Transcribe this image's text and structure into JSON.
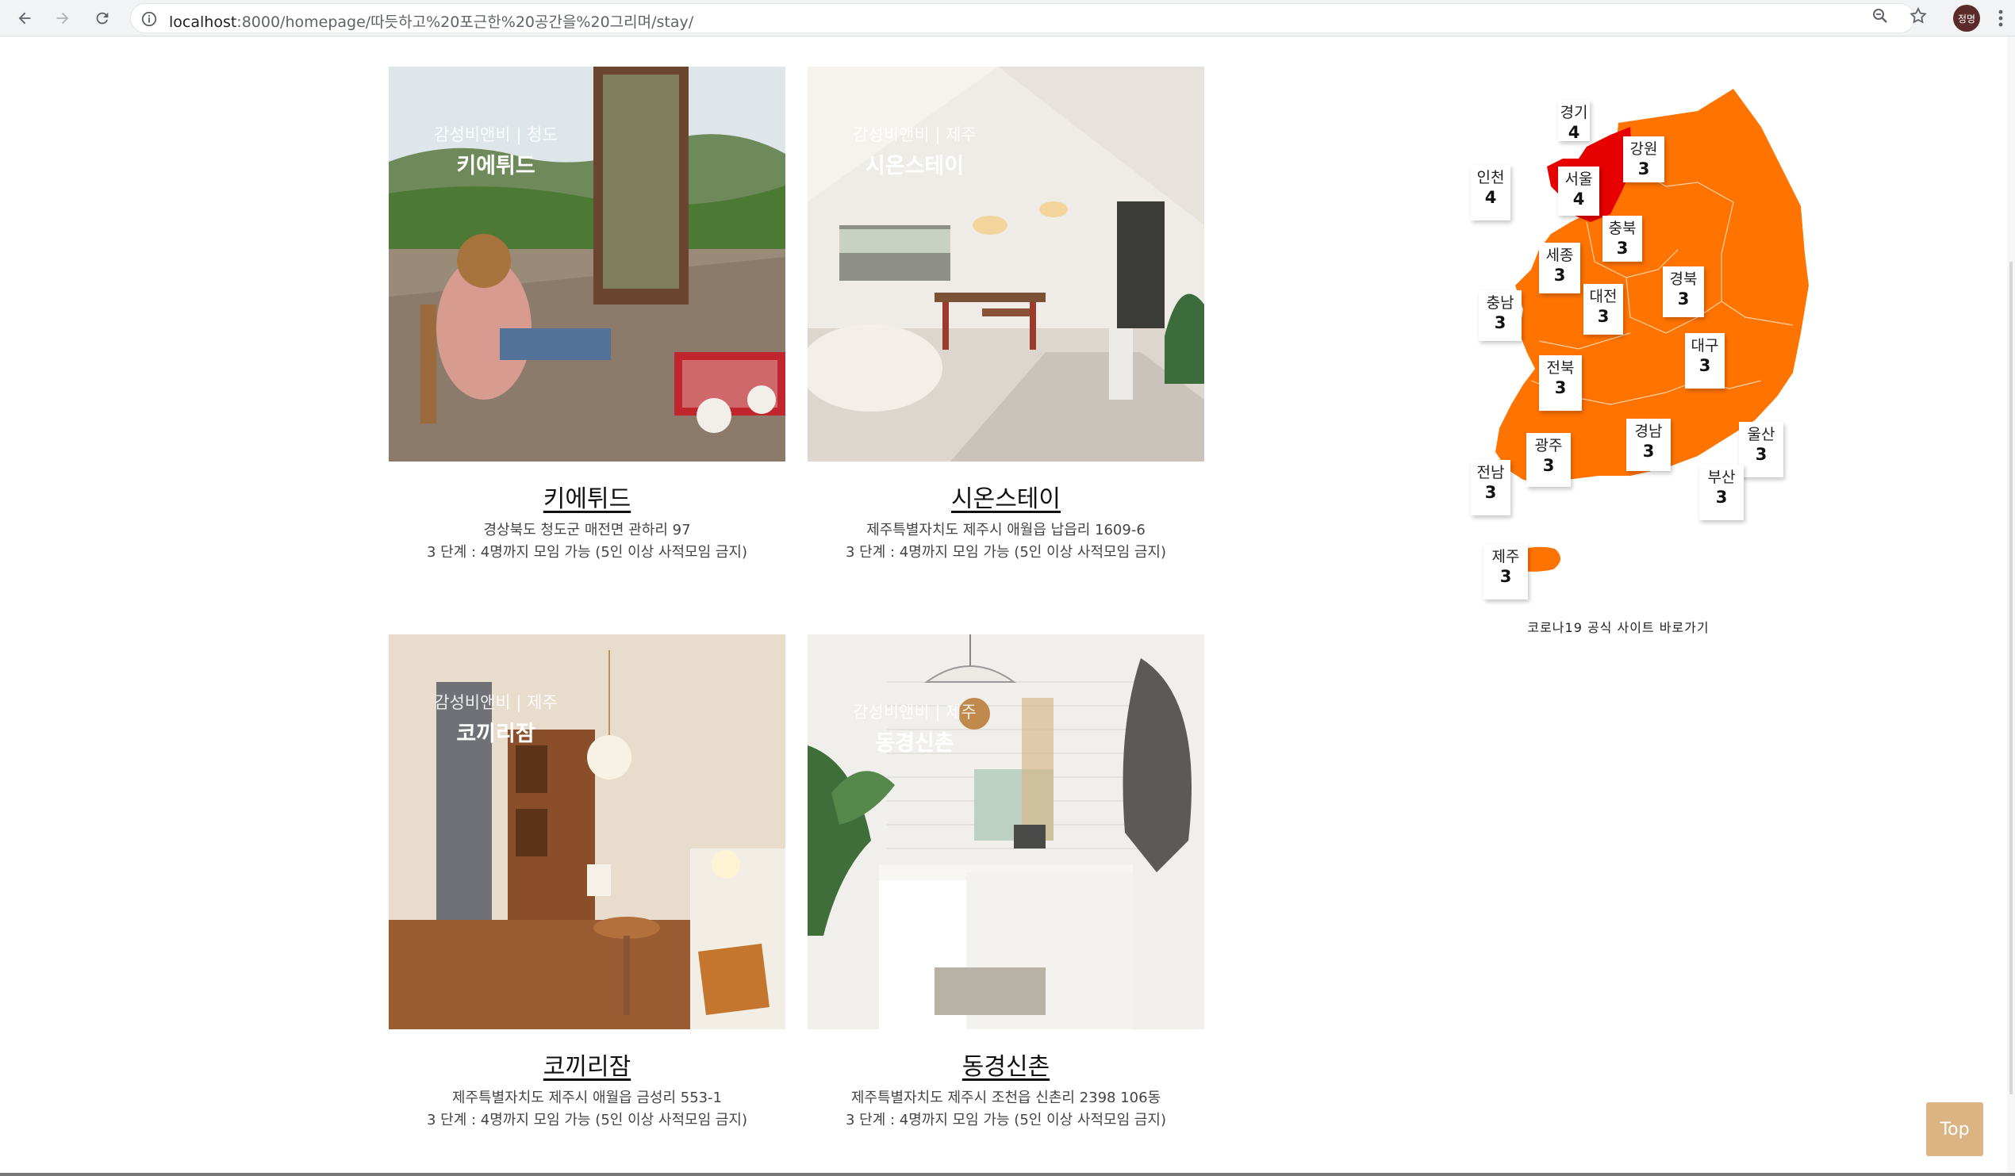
{
  "browser": {
    "url_host": "localhost",
    "url_rest": ":8000/homepage/따듯하고%20포근한%20공간을%20그리며/stay/",
    "profile_initials": "정명"
  },
  "cards": [
    {
      "overlay_sub": "감성비앤비 | 청도",
      "overlay_name": "키에튀드",
      "title": "키에튀드",
      "address": "경상북도 청도군 매전면 관하리 97",
      "rule": "3 단계 : 4명까지 모임 가능 (5인 이상 사적모임 금지)"
    },
    {
      "overlay_sub": "감성비앤비 | 제주",
      "overlay_name": "시온스테이",
      "title": "시온스테이",
      "address": "제주특별자치도 제주시 애월읍 납읍리 1609-6",
      "rule": "3 단계 : 4명까지 모임 가능 (5인 이상 사적모임 금지)"
    },
    {
      "overlay_sub": "감성비앤비 | 제주",
      "overlay_name": "코끼리잠",
      "title": "코끼리잠",
      "address": "제주특별자치도 제주시 애월읍 금성리 553-1",
      "rule": "3 단계 : 4명까지 모임 가능 (5인 이상 사적모임 금지)"
    },
    {
      "overlay_sub": "감성비앤비 | 제주",
      "overlay_name": "동경신촌",
      "title": "동경신촌",
      "address": "제주특별자치도 제주시 조천읍 신촌리 2398 106동",
      "rule": "3 단계 : 4명까지 모임 가능 (5인 이상 사적모임 금지)"
    }
  ],
  "map": {
    "colors": {
      "level3": "#ff7300",
      "level4": "#e60000"
    },
    "regions": [
      {
        "name": "경기",
        "level": "4"
      },
      {
        "name": "강원",
        "level": "3"
      },
      {
        "name": "인천",
        "level": "4"
      },
      {
        "name": "서울",
        "level": "4"
      },
      {
        "name": "충북",
        "level": "3"
      },
      {
        "name": "세종",
        "level": "3"
      },
      {
        "name": "경북",
        "level": "3"
      },
      {
        "name": "충남",
        "level": "3"
      },
      {
        "name": "대전",
        "level": "3"
      },
      {
        "name": "대구",
        "level": "3"
      },
      {
        "name": "전북",
        "level": "3"
      },
      {
        "name": "경남",
        "level": "3"
      },
      {
        "name": "울산",
        "level": "3"
      },
      {
        "name": "광주",
        "level": "3"
      },
      {
        "name": "전남",
        "level": "3"
      },
      {
        "name": "부산",
        "level": "3"
      },
      {
        "name": "제주",
        "level": "3"
      }
    ],
    "link_text": "코로나19 공식 사이트 바로가기"
  },
  "top_button": "Top"
}
